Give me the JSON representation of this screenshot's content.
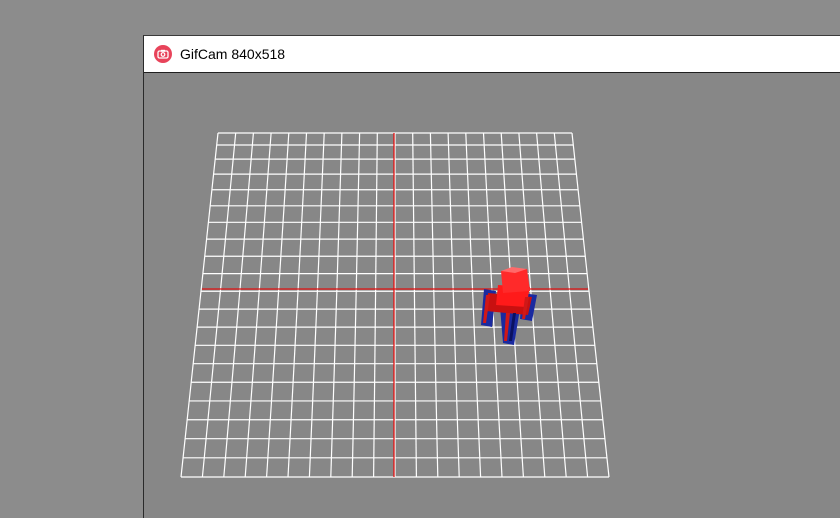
{
  "window": {
    "title": "GifCam 840x518",
    "icon": "camera-icon"
  },
  "scene": {
    "grid_color": "#ffffff",
    "axis_color": "#e01010",
    "background_color": "#878787",
    "object": "robot-model",
    "object_colors": [
      "#ff1a1a",
      "#1a2aa0"
    ]
  }
}
